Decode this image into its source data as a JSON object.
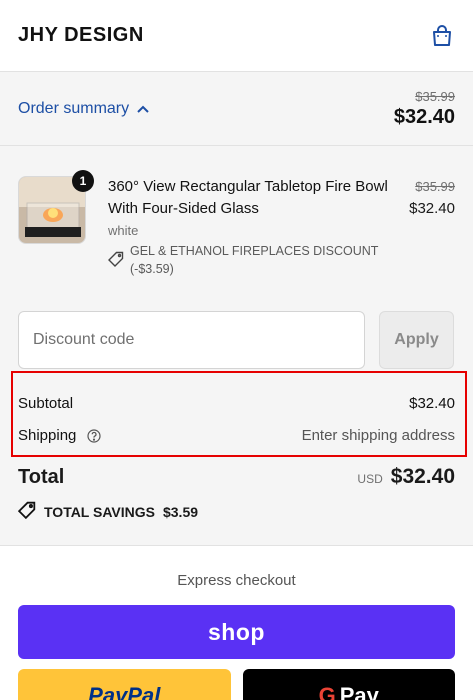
{
  "header": {
    "brand": "JHY DESIGN",
    "cart_icon": "shopping-bag-icon"
  },
  "summary": {
    "toggle_label": "Order summary",
    "chevron_icon": "chevron-up-icon",
    "original_total": "$35.99",
    "total": "$32.40"
  },
  "line_item": {
    "quantity": "1",
    "title": "360° View Rectangular Tabletop Fire Bowl With Four-Sided Glass",
    "variant": "white",
    "discount_icon": "tag-icon",
    "discount_label": "GEL & ETHANOL FIREPLACES DISCOUNT (-$3.59)",
    "original_price": "$35.99",
    "price": "$32.40"
  },
  "discount": {
    "placeholder": "Discount code",
    "apply_label": "Apply"
  },
  "totals": {
    "subtotal_label": "Subtotal",
    "subtotal_value": "$32.40",
    "shipping_label": "Shipping",
    "shipping_value": "Enter shipping address",
    "total_label": "Total",
    "currency": "USD",
    "total_value": "$32.40",
    "savings_label": "TOTAL SAVINGS",
    "savings_value": "$3.59"
  },
  "express": {
    "title": "Express checkout",
    "shop_label": "shop",
    "paypal_label": "PayPal",
    "gpay_label": "Pay"
  },
  "colors": {
    "accent": "#1d4fa5",
    "shop_purple": "#5a31f4",
    "paypal_yellow": "#ffc439",
    "highlight_red": "#e60000"
  }
}
